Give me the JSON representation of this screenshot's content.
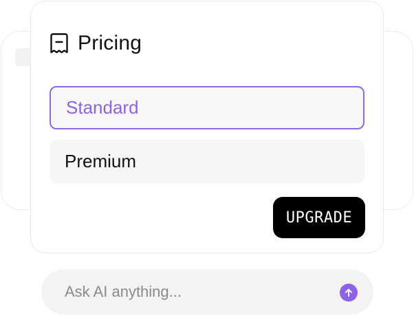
{
  "pricing_card": {
    "title": "Pricing",
    "icon": "receipt-icon",
    "options": [
      {
        "label": "Standard",
        "selected": true
      },
      {
        "label": "Premium",
        "selected": false
      }
    ],
    "upgrade_label": "UPGRADE"
  },
  "ask_bar": {
    "placeholder": "Ask AI anything...",
    "send_icon": "arrow-up-icon"
  },
  "colors": {
    "accent": "#8e61ea",
    "button_bg": "#000000",
    "option_bg": "#f6f6f6"
  }
}
